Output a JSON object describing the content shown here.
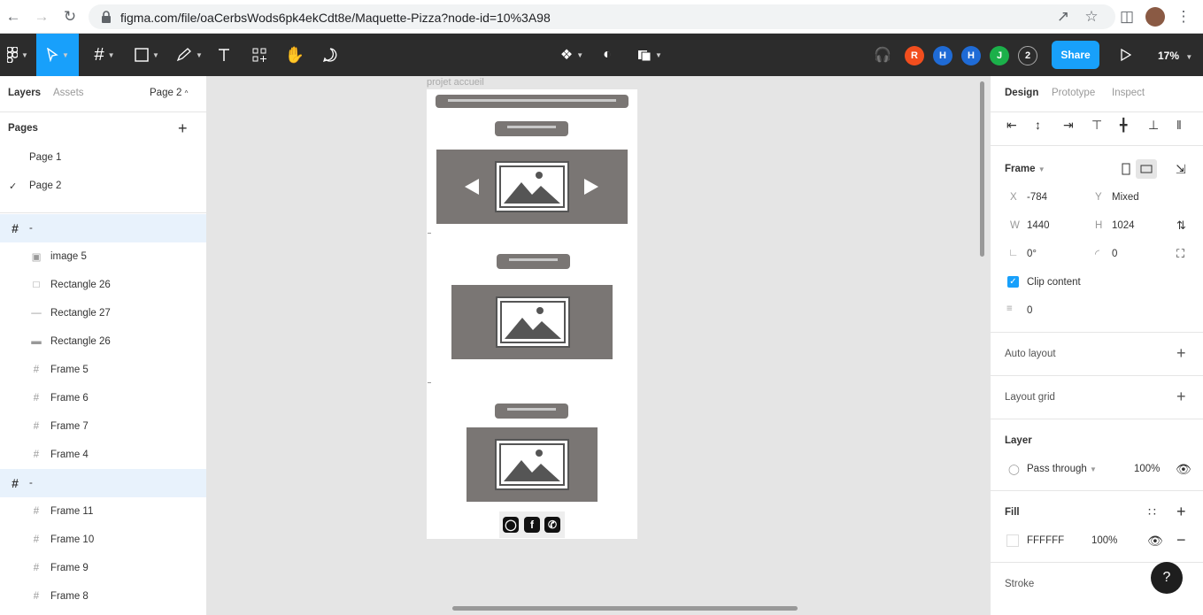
{
  "browser": {
    "url": "figma.com/file/oaCerbsWods6pk4ekCdt8e/Maquette-Pizza?node-id=10%3A98"
  },
  "toolbar": {
    "collaborators": [
      {
        "initial": "R",
        "color": "#f24e1e"
      },
      {
        "initial": "H",
        "color": "#1f6bd6"
      },
      {
        "initial": "H",
        "color": "#1f6bd6"
      },
      {
        "initial": "J",
        "color": "#1bb04a"
      }
    ],
    "extra_count": "2",
    "share_label": "Share",
    "zoom": "17%"
  },
  "left_panel": {
    "tab_layers": "Layers",
    "tab_assets": "Assets",
    "page_selector": "Page 2",
    "pages_header": "Pages",
    "pages": [
      "Page 1",
      "Page 2"
    ],
    "layers": [
      {
        "name": "-",
        "icon": "frame-icon",
        "level": 0
      },
      {
        "name": "image 5",
        "icon": "image-icon",
        "level": 1
      },
      {
        "name": "Rectangle 26",
        "icon": "rectangle-icon",
        "level": 1
      },
      {
        "name": "Rectangle 27",
        "icon": "line-icon",
        "level": 1
      },
      {
        "name": "Rectangle 26",
        "icon": "thin-rectangle-icon",
        "level": 1
      },
      {
        "name": "Frame 5",
        "icon": "frame-icon",
        "level": 1
      },
      {
        "name": "Frame 6",
        "icon": "frame-icon",
        "level": 1
      },
      {
        "name": "Frame 7",
        "icon": "frame-icon",
        "level": 1
      },
      {
        "name": "Frame 4",
        "icon": "frame-icon",
        "level": 1
      },
      {
        "name": "-",
        "icon": "frame-icon",
        "level": 0
      },
      {
        "name": "Frame 11",
        "icon": "frame-icon",
        "level": 1
      },
      {
        "name": "Frame 10",
        "icon": "frame-icon",
        "level": 1
      },
      {
        "name": "Frame 9",
        "icon": "frame-icon",
        "level": 1
      },
      {
        "name": "Frame 8",
        "icon": "frame-icon",
        "level": 1
      }
    ]
  },
  "canvas": {
    "frame_label": "projet accueil"
  },
  "right_panel": {
    "tabs": [
      "Design",
      "Prototype",
      "Inspect"
    ],
    "frame_section": "Frame",
    "x_label": "X",
    "x_value": "-784",
    "y_label": "Y",
    "y_value": "Mixed",
    "w_label": "W",
    "w_value": "1440",
    "h_label": "H",
    "h_value": "1024",
    "rotation": "0°",
    "radius": "0",
    "clip_content": "Clip content",
    "spacing": "0",
    "auto_layout": "Auto layout",
    "layout_grid": "Layout grid",
    "layer_section": "Layer",
    "blend_mode": "Pass through",
    "opacity": "100%",
    "fill_section": "Fill",
    "fill_hex": "FFFFFF",
    "fill_opacity": "100%",
    "stroke_section": "Stroke",
    "help": "?"
  }
}
